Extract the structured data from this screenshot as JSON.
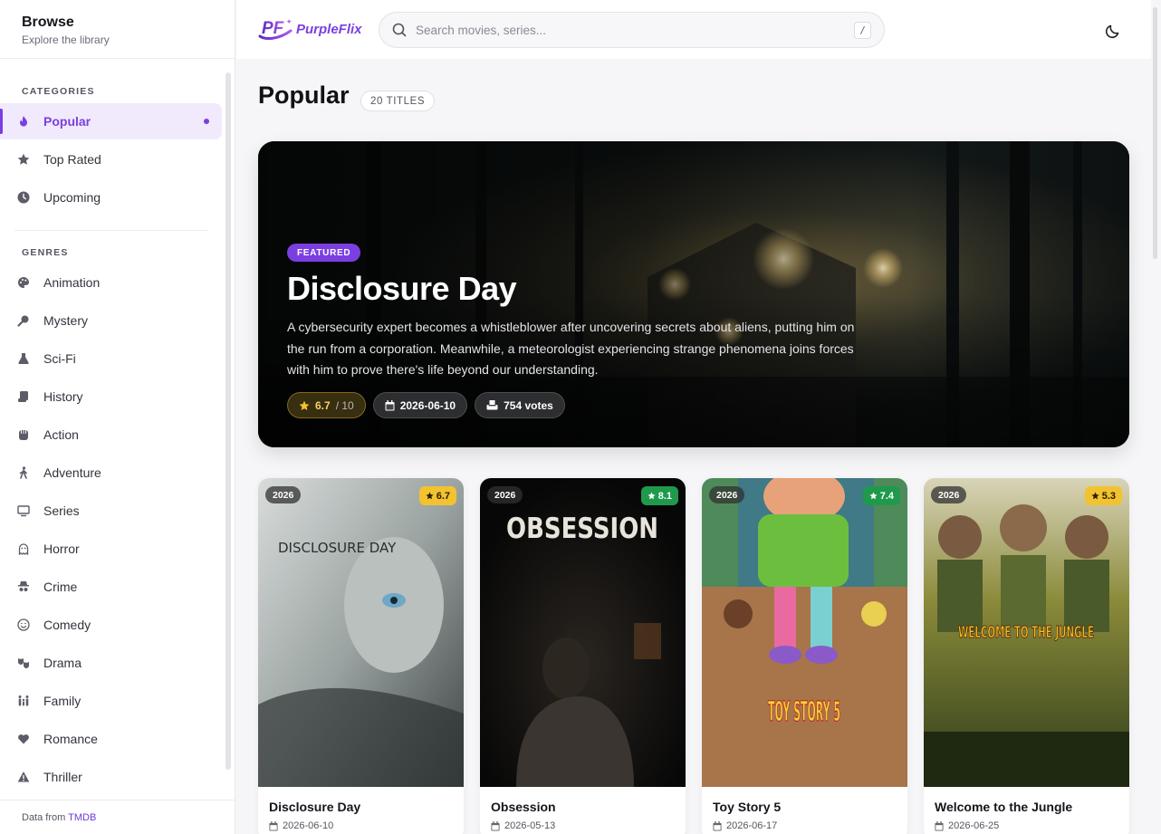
{
  "sidebar": {
    "title": "Browse",
    "subtitle": "Explore the library",
    "categories_label": "CATEGORIES",
    "categories": [
      {
        "label": "Popular",
        "icon": "flame-icon",
        "active": true
      },
      {
        "label": "Top Rated",
        "icon": "star-icon"
      },
      {
        "label": "Upcoming",
        "icon": "clock-icon"
      }
    ],
    "genres_label": "GENRES",
    "genres": [
      {
        "label": "Animation",
        "icon": "palette-icon"
      },
      {
        "label": "Mystery",
        "icon": "magnifier-icon"
      },
      {
        "label": "Sci-Fi",
        "icon": "flask-icon"
      },
      {
        "label": "History",
        "icon": "scroll-icon"
      },
      {
        "label": "Action",
        "icon": "fist-icon"
      },
      {
        "label": "Adventure",
        "icon": "hiker-icon"
      },
      {
        "label": "Series",
        "icon": "tv-icon"
      },
      {
        "label": "Horror",
        "icon": "ghost-icon"
      },
      {
        "label": "Crime",
        "icon": "spy-icon"
      },
      {
        "label": "Comedy",
        "icon": "smile-icon"
      },
      {
        "label": "Drama",
        "icon": "masks-icon"
      },
      {
        "label": "Family",
        "icon": "people-icon"
      },
      {
        "label": "Romance",
        "icon": "heart-icon"
      },
      {
        "label": "Thriller",
        "icon": "warning-icon"
      }
    ],
    "footer_prefix": "Data from",
    "footer_link": "TMDB"
  },
  "topbar": {
    "logo_text": "PurpleFlix",
    "logo_mark": "PF",
    "search_placeholder": "Search movies, series...",
    "search_shortcut": "/",
    "theme_icon": "moon-icon"
  },
  "main": {
    "title": "Popular",
    "count_badge": "20 TITLES"
  },
  "hero": {
    "badge": "FEATURED",
    "title": "Disclosure Day",
    "description": "A cybersecurity expert becomes a whistleblower after uncovering secrets about aliens, putting him on the run from a corporation. Meanwhile, a meteorologist experiencing strange phenomena joins forces with him to prove there's life beyond our understanding.",
    "rating": "6.7",
    "rating_max": "/ 10",
    "date": "2026-06-10",
    "votes": "754 votes"
  },
  "cards": [
    {
      "title": "Disclosure Day",
      "year": "2026",
      "rating": "6.7",
      "date": "2026-06-10",
      "rating_color": "#f2c230",
      "poster_text": "DISCLOSURE DAY"
    },
    {
      "title": "Obsession",
      "year": "2026",
      "rating": "8.1",
      "date": "2026-05-13",
      "rating_color": "#1f9a4d",
      "poster_text": "OBSESSION"
    },
    {
      "title": "Toy Story 5",
      "year": "2026",
      "rating": "7.4",
      "date": "2026-06-17",
      "rating_color": "#1f9a4d",
      "poster_text": "TOY STORY 5"
    },
    {
      "title": "Welcome to the Jungle",
      "year": "2026",
      "rating": "5.3",
      "date": "2026-06-25",
      "rating_color": "#f2c230",
      "poster_text": "WELCOME TO THE JUNGLE"
    }
  ],
  "colors": {
    "accent": "#7b3fe0",
    "rating_high": "#1f9a4d",
    "rating_mid": "#f2c230"
  }
}
